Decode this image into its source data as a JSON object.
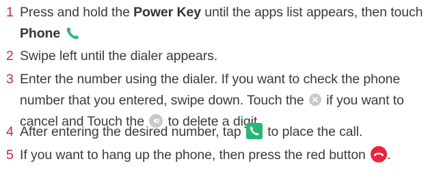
{
  "colors": {
    "step_number": "#c0255b",
    "phone_green": "#2bb673",
    "end_red": "#e8263b",
    "grey_icon": "#c9c9c9"
  },
  "steps": [
    {
      "number": "1",
      "text_a": "Press and hold the ",
      "bold_a": "Power Key",
      "text_b": " until the apps list appears, then touch",
      "bold_b": "Phone",
      "icon": "phone-handset-icon"
    },
    {
      "number": "2",
      "text": "Swipe left until the dialer appears."
    },
    {
      "number": "3",
      "line1": "Enter the number using the dialer. If you want to check the phone",
      "line2a": "number that you entered, swipe down. Touch the ",
      "line2b": " if you want to",
      "line3a": "cancel and Touch the ",
      "line3b": " to delete a digit.",
      "icons": [
        "clear-circle-icon",
        "backspace-circle-icon"
      ]
    },
    {
      "number": "4",
      "text_a": "After entering the desired number, tap ",
      "text_b": " to place the call.",
      "icon": "call-button-icon"
    },
    {
      "number": "5",
      "text_a": "If you want to hang up the phone, then press the red button ",
      "text_b": ".",
      "icon": "end-call-icon"
    }
  ]
}
